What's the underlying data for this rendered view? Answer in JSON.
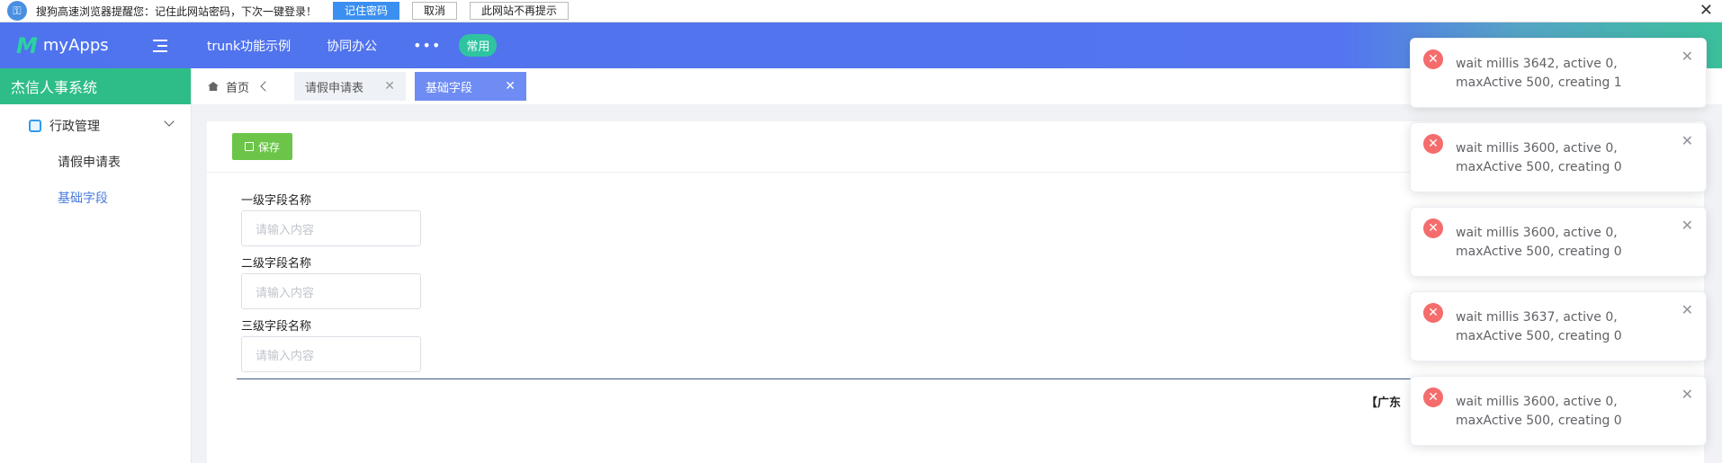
{
  "browser_bar": {
    "message": "搜狗高速浏览器提醒您：记住此网站密码，下次一键登录！",
    "remember_label": "记住密码",
    "cancel_label": "取消",
    "never_label": "此网站不再提示",
    "close_label": "✕"
  },
  "header": {
    "logo_text": "myApps",
    "nav": [
      "trunk功能示例",
      "协同办公"
    ],
    "more_label": "•••",
    "pill_label": "常用"
  },
  "sidebar": {
    "system_title": "杰信人事系统",
    "group_label": "行政管理",
    "items": [
      {
        "label": "请假申请表",
        "active": false
      },
      {
        "label": "基础字段",
        "active": true
      }
    ]
  },
  "tabs": {
    "home_label": "首页",
    "items": [
      {
        "label": "请假申请表",
        "active": false
      },
      {
        "label": "基础字段",
        "active": true
      }
    ]
  },
  "toolbar": {
    "save_label": "保存"
  },
  "form": {
    "fields": [
      {
        "label": "一级字段名称",
        "placeholder": "请输入内容"
      },
      {
        "label": "二级字段名称",
        "placeholder": "请输入内容"
      },
      {
        "label": "三级字段名称",
        "placeholder": "请输入内容"
      }
    ],
    "footer_text": "【广东"
  },
  "notifications": [
    {
      "message": "wait millis 3642, active 0, maxActive 500, creating 1"
    },
    {
      "message": "wait millis 3600, active 0, maxActive 500, creating 0"
    },
    {
      "message": "wait millis 3600, active 0, maxActive 500, creating 0"
    },
    {
      "message": "wait millis 3637, active 0, maxActive 500, creating 0"
    },
    {
      "message": "wait millis 3600, active 0, maxActive 500, creating 0"
    }
  ],
  "colors": {
    "header": "#5475ef",
    "sidebar_title": "#2ebd88",
    "save_button": "#6cc548",
    "active_tab": "#6e8cf3",
    "error": "#f56c6c"
  }
}
